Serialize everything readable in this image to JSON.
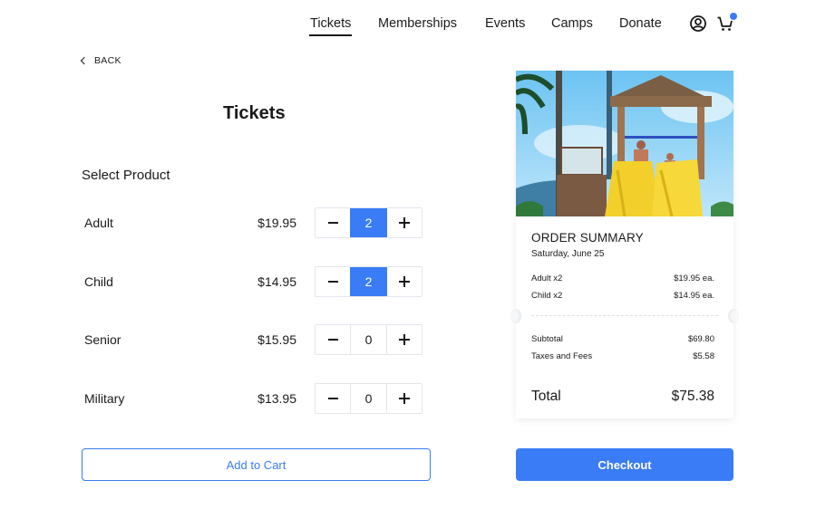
{
  "nav": {
    "items": [
      {
        "label": "Tickets",
        "active": true
      },
      {
        "label": "Memberships",
        "active": false
      },
      {
        "label": "Events",
        "active": false
      },
      {
        "label": "Camps",
        "active": false
      },
      {
        "label": "Donate",
        "active": false
      }
    ],
    "icons": {
      "account": "user-circle-icon",
      "cart": "cart-icon"
    },
    "cart_has_items": true
  },
  "back_label": "BACK",
  "page_title": "Tickets",
  "section_title": "Select Product",
  "products": [
    {
      "name": "Adult",
      "price": "$19.95",
      "quantity": "2",
      "selected": true
    },
    {
      "name": "Child",
      "price": "$14.95",
      "quantity": "2",
      "selected": true
    },
    {
      "name": "Senior",
      "price": "$15.95",
      "quantity": "0",
      "selected": false
    },
    {
      "name": "Military",
      "price": "$13.95",
      "quantity": "0",
      "selected": false
    }
  ],
  "add_to_cart_label": "Add to Cart",
  "checkout_label": "Checkout",
  "summary": {
    "image_alt": "Water slide with palm trees",
    "title": "ORDER SUMMARY",
    "date": "Saturday, June 25",
    "lines": [
      {
        "label": "Adult x2",
        "value": "$19.95 ea."
      },
      {
        "label": "Child x2",
        "value": "$14.95 ea."
      }
    ],
    "subtotal_label": "Subtotal",
    "subtotal_value": "$69.80",
    "taxes_label": "Taxes and Fees",
    "taxes_value": "$5.58",
    "total_label": "Total",
    "total_value": "$75.38"
  },
  "colors": {
    "accent": "#3a7cf5",
    "text": "#1a1a1a",
    "border": "#e3e6ee"
  }
}
